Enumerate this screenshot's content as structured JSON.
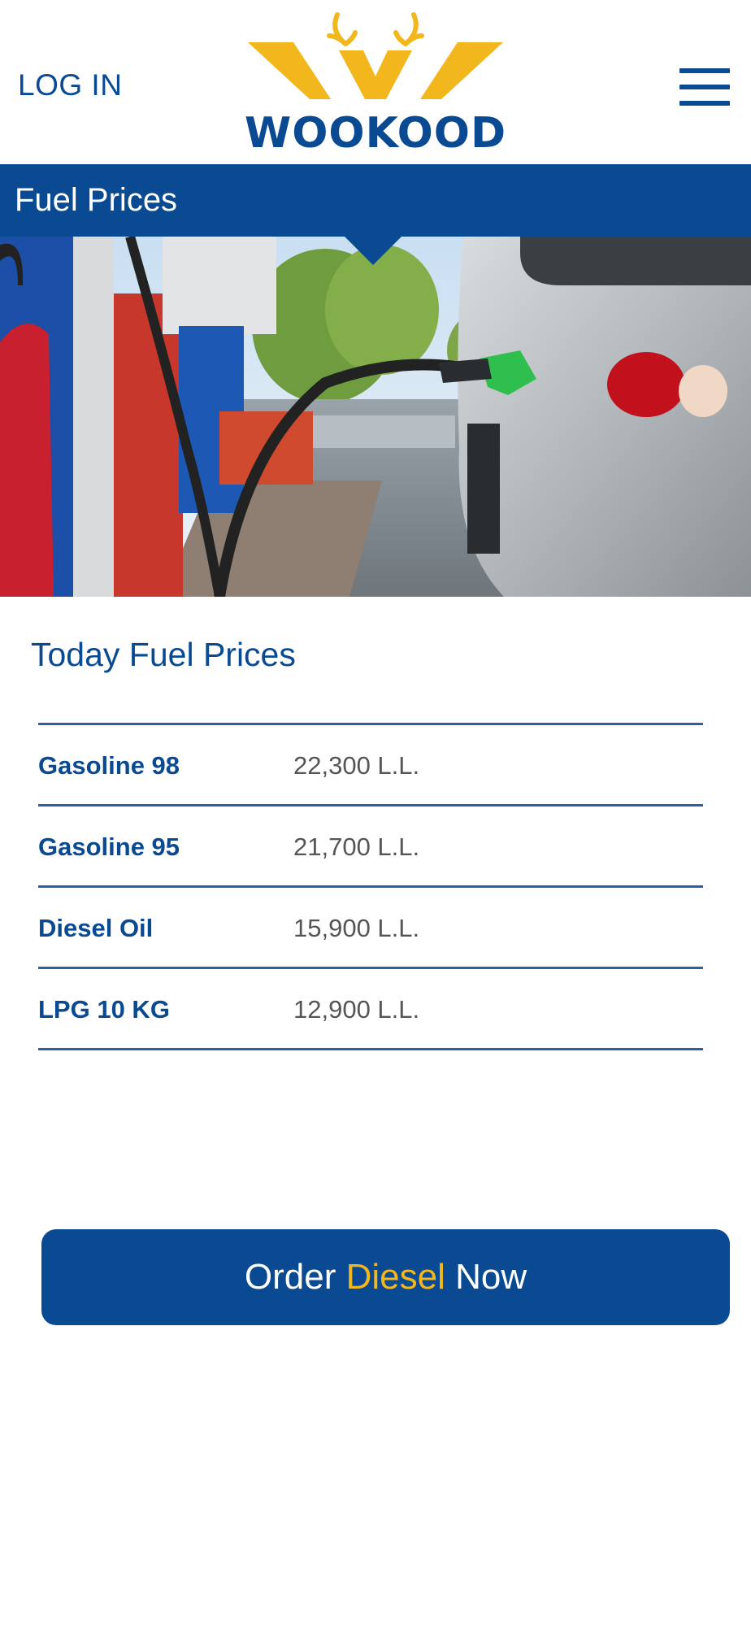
{
  "header": {
    "login_label": "LOG IN",
    "logo_text": "WOOKOOD",
    "menu_icon": "hamburger-menu-icon"
  },
  "band": {
    "title": "Fuel Prices"
  },
  "hero": {
    "description_icon": "fuel-pump-photo"
  },
  "section": {
    "title": "Today Fuel Prices"
  },
  "prices": [
    {
      "name": "Gasoline 98",
      "price": "22,300 L.L."
    },
    {
      "name": "Gasoline 95",
      "price": "21,700 L.L."
    },
    {
      "name": "Diesel Oil",
      "price": "15,900 L.L."
    },
    {
      "name": "LPG 10 KG",
      "price": "12,900 L.L."
    }
  ],
  "order_button": {
    "prefix": "Order",
    "highlight": "Diesel",
    "suffix": "Now"
  },
  "colors": {
    "brand_blue": "#0a4a93",
    "brand_yellow": "#f3b71e"
  }
}
